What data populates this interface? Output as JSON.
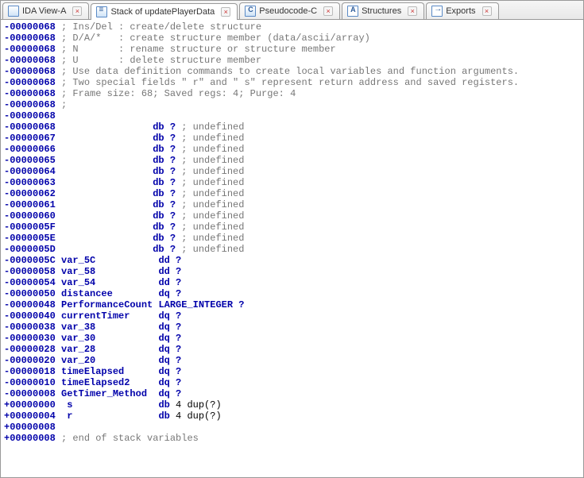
{
  "tabs": [
    {
      "label": "IDA View-A",
      "icon": "doc-icon",
      "active": false
    },
    {
      "label": "Stack of updatePlayerData",
      "icon": "stack-icon",
      "active": true
    },
    {
      "label": "Pseudocode-C",
      "icon": "pseudo-icon",
      "active": false
    },
    {
      "label": "Structures",
      "icon": "struct-icon",
      "active": false
    },
    {
      "label": "Exports",
      "icon": "exports-icon",
      "active": false
    }
  ],
  "comment_lines": [
    {
      "addr": "-00000068",
      "text": "; Ins/Del : create/delete structure"
    },
    {
      "addr": "-00000068",
      "text": "; D/A/*   : create structure member (data/ascii/array)"
    },
    {
      "addr": "-00000068",
      "text": "; N       : rename structure or structure member"
    },
    {
      "addr": "-00000068",
      "text": "; U       : delete structure member"
    },
    {
      "addr": "-00000068",
      "text": "; Use data definition commands to create local variables and function arguments."
    },
    {
      "addr": "-00000068",
      "text": "; Two special fields \" r\" and \" s\" represent return address and saved registers."
    },
    {
      "addr": "-00000068",
      "text": "; Frame size: 68; Saved regs: 4; Purge: 4"
    },
    {
      "addr": "-00000068",
      "text": ";"
    },
    {
      "addr": "-00000068",
      "text": ""
    }
  ],
  "undef_lines": [
    {
      "addr": "-00000068"
    },
    {
      "addr": "-00000067"
    },
    {
      "addr": "-00000066"
    },
    {
      "addr": "-00000065"
    },
    {
      "addr": "-00000064"
    },
    {
      "addr": "-00000063"
    },
    {
      "addr": "-00000062"
    },
    {
      "addr": "-00000061"
    },
    {
      "addr": "-00000060"
    },
    {
      "addr": "-0000005F"
    },
    {
      "addr": "-0000005E"
    },
    {
      "addr": "-0000005D"
    }
  ],
  "undef_kw": "db",
  "undef_q": "?",
  "undef_comment": "; undefined",
  "var_lines": [
    {
      "addr": "-0000005C",
      "name": "var_5C",
      "type": "dd",
      "val": "?"
    },
    {
      "addr": "-00000058",
      "name": "var_58",
      "type": "dd",
      "val": "?"
    },
    {
      "addr": "-00000054",
      "name": "var_54",
      "type": "dd",
      "val": "?"
    },
    {
      "addr": "-00000050",
      "name": "distancee",
      "type": "dq",
      "val": "?"
    },
    {
      "addr": "-00000048",
      "name": "PerformanceCount",
      "type": "LARGE_INTEGER",
      "val": "?"
    },
    {
      "addr": "-00000040",
      "name": "currentTimer",
      "type": "dq",
      "val": "?"
    },
    {
      "addr": "-00000038",
      "name": "var_38",
      "type": "dq",
      "val": "?"
    },
    {
      "addr": "-00000030",
      "name": "var_30",
      "type": "dq",
      "val": "?"
    },
    {
      "addr": "-00000028",
      "name": "var_28",
      "type": "dq",
      "val": "?"
    },
    {
      "addr": "-00000020",
      "name": "var_20",
      "type": "dq",
      "val": "?"
    },
    {
      "addr": "-00000018",
      "name": "timeElapsed",
      "type": "dq",
      "val": "?"
    },
    {
      "addr": "-00000010",
      "name": "timeElapsed2",
      "type": "dq",
      "val": "?"
    },
    {
      "addr": "-00000008",
      "name": "GetTimer_Method",
      "type": "dq",
      "val": "?"
    }
  ],
  "pos_lines": [
    {
      "addr": "+00000000",
      "name": " s",
      "type": "db",
      "val": "4 dup(?)"
    },
    {
      "addr": "+00000004",
      "name": " r",
      "type": "db",
      "val": "4 dup(?)"
    }
  ],
  "blank_lines": [
    {
      "addr": "+00000008",
      "text": ""
    },
    {
      "addr": "+00000008",
      "text": "; end of stack variables"
    }
  ]
}
